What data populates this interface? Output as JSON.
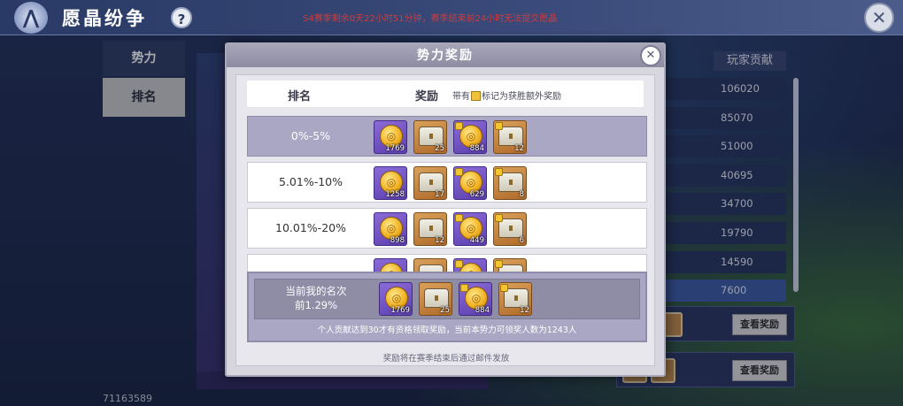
{
  "header": {
    "title": "愿晶纷争",
    "help_icon_glyph": "?",
    "season_notice": "S4赛季剩余0天22小时51分钟，赛季结束前24小时无法提交愿晶",
    "close_glyph": "✕"
  },
  "left_tabs": [
    {
      "label": "势力"
    },
    {
      "label": "排名"
    }
  ],
  "player_id": "71163589",
  "contribution": {
    "header": "玩家贡献",
    "values": [
      "106020",
      "85070",
      "51000",
      "40695",
      "34700",
      "19790",
      "14590",
      "7600"
    ]
  },
  "background_buttons": {
    "view_rewards": "查看奖励"
  },
  "modal": {
    "title": "势力奖励",
    "close_glyph": "✕",
    "columns": {
      "rank": "排名",
      "reward": "奖励",
      "note_prefix": "带有",
      "note_suffix": "标记为获胜额外奖励"
    },
    "tiers": [
      {
        "range": "0%-5%",
        "items": [
          {
            "type": "coin",
            "qty": "1769",
            "bonus": false
          },
          {
            "type": "chest",
            "qty": "25",
            "bonus": false
          },
          {
            "type": "coin",
            "qty": "884",
            "bonus": true
          },
          {
            "type": "chest",
            "qty": "12",
            "bonus": true
          }
        ]
      },
      {
        "range": "5.01%-10%",
        "items": [
          {
            "type": "coin",
            "qty": "1258",
            "bonus": false
          },
          {
            "type": "chest",
            "qty": "17",
            "bonus": false
          },
          {
            "type": "coin",
            "qty": "629",
            "bonus": true
          },
          {
            "type": "chest",
            "qty": "8",
            "bonus": true
          }
        ]
      },
      {
        "range": "10.01%-20%",
        "items": [
          {
            "type": "coin",
            "qty": "898",
            "bonus": false
          },
          {
            "type": "chest",
            "qty": "12",
            "bonus": false
          },
          {
            "type": "coin",
            "qty": "449",
            "bonus": true
          },
          {
            "type": "chest",
            "qty": "6",
            "bonus": true
          }
        ]
      },
      {
        "range": "",
        "items": [
          {
            "type": "coin",
            "qty": "",
            "bonus": false
          },
          {
            "type": "chest",
            "qty": "",
            "bonus": false
          },
          {
            "type": "coin",
            "qty": "",
            "bonus": true
          },
          {
            "type": "chest",
            "qty": "",
            "bonus": true
          }
        ]
      }
    ],
    "my_rank": {
      "label_line1": "当前我的名次",
      "label_line2": "前1.29%",
      "items": [
        {
          "type": "coin",
          "qty": "1769",
          "bonus": false
        },
        {
          "type": "chest",
          "qty": "25",
          "bonus": false
        },
        {
          "type": "coin",
          "qty": "884",
          "bonus": true
        },
        {
          "type": "chest",
          "qty": "12",
          "bonus": true
        }
      ],
      "footer": "个人贡献达到30才有资格领取奖励，当前本势力可领奖人数为1243人"
    },
    "bottom_note": "奖励将在赛季结束后通过邮件发放"
  }
}
